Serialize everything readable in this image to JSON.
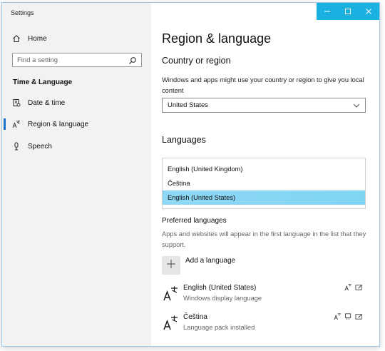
{
  "window": {
    "title": "Settings"
  },
  "sidebar": {
    "home_label": "Home",
    "search_placeholder": "Find a setting",
    "section_title": "Time & Language",
    "items": [
      {
        "label": "Date & time",
        "icon": "calendar-icon"
      },
      {
        "label": "Region & language",
        "icon": "language-icon",
        "selected": true
      },
      {
        "label": "Speech",
        "icon": "microphone-icon"
      }
    ]
  },
  "main": {
    "page_title": "Region & language",
    "country": {
      "heading": "Country or region",
      "description": "Windows and apps might use your country or region to give you local content",
      "selected": "United States"
    },
    "languages": {
      "heading": "Languages",
      "list": [
        "English (United Kingdom)",
        "Čeština",
        "English (United States)"
      ],
      "selected_index": 2
    },
    "preferred": {
      "heading": "Preferred languages",
      "description": "Apps and websites will appear in the first language in the list that they support.",
      "add_label": "Add a language",
      "items": [
        {
          "name": "English (United States)",
          "status": "Windows display language"
        },
        {
          "name": "Čeština",
          "status": "Language pack installed"
        }
      ]
    }
  },
  "colors": {
    "accent": "#1ab1e1",
    "selection": "#8fd8f5",
    "selected_bar": "#1a73c8"
  }
}
